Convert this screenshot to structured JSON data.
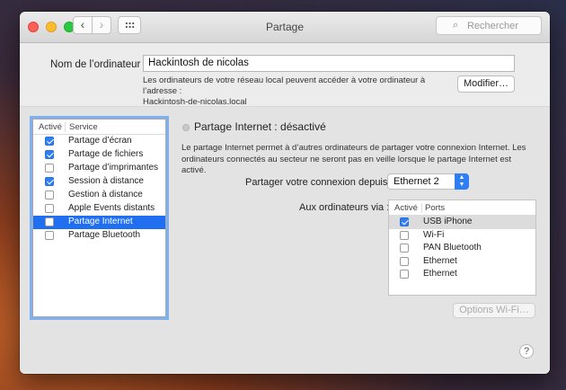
{
  "window": {
    "title": "Partage"
  },
  "toolbar": {
    "search_placeholder": "Rechercher"
  },
  "computer": {
    "label": "Nom de l’ordinateur :",
    "name": "Hackintosh de nicolas",
    "address_line1": "Les ordinateurs de votre réseau local peuvent accéder à votre ordinateur à l’adresse :",
    "address_line2": "Hackintosh-de-nicolas.local",
    "modify_label": "Modifier…"
  },
  "services": {
    "col_enabled": "Activé",
    "col_service": "Service",
    "items": [
      {
        "name": "Partage d’écran",
        "checked": true,
        "selected": false
      },
      {
        "name": "Partage de fichiers",
        "checked": true,
        "selected": false
      },
      {
        "name": "Partage d’imprimantes",
        "checked": false,
        "selected": false
      },
      {
        "name": "Session à distance",
        "checked": true,
        "selected": false
      },
      {
        "name": "Gestion à distance",
        "checked": false,
        "selected": false
      },
      {
        "name": "Apple Events distants",
        "checked": false,
        "selected": false
      },
      {
        "name": "Partage Internet",
        "checked": false,
        "selected": true
      },
      {
        "name": "Partage Bluetooth",
        "checked": false,
        "selected": false
      }
    ]
  },
  "detail": {
    "status": "Partage Internet : désactivé",
    "description": "Le partage Internet permet à d’autres ordinateurs de partager votre connexion Internet. Les ordinateurs connectés au secteur ne seront pas en veille lorsque le partage Internet est activé.",
    "share_from_label": "Partager votre connexion depuis :",
    "share_from_value": "Ethernet 2",
    "via_label": "Aux ordinateurs via :",
    "ports_col_enabled": "Activé",
    "ports_col_ports": "Ports",
    "ports": [
      {
        "name": "USB iPhone",
        "checked": true
      },
      {
        "name": "Wi-Fi",
        "checked": false
      },
      {
        "name": "PAN Bluetooth",
        "checked": false
      },
      {
        "name": "Ethernet",
        "checked": false
      },
      {
        "name": "Ethernet",
        "checked": false
      }
    ],
    "wifi_options_label": "Options Wi-Fi…"
  },
  "help": {
    "label": "?"
  }
}
